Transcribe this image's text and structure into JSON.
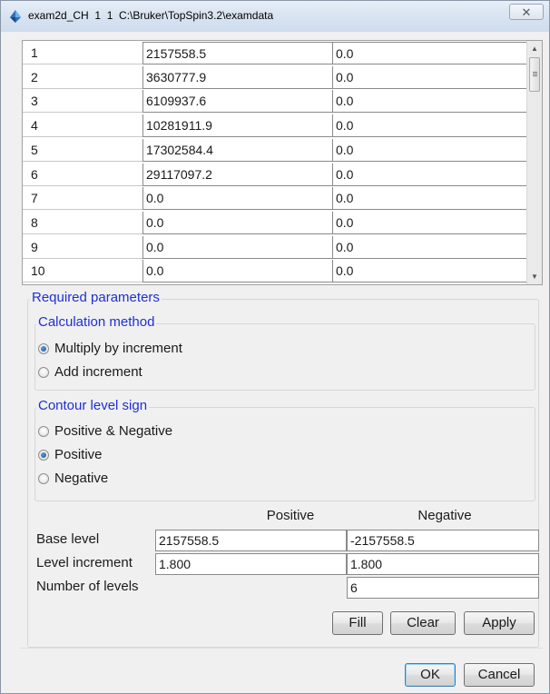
{
  "window": {
    "title": "exam2d_CH  1  1  C:\\Bruker\\TopSpin3.2\\examdata",
    "close_glyph": "✕",
    "icon": "topspin-app-icon"
  },
  "table": {
    "rows": [
      {
        "index": "1",
        "positive": "2157558.5",
        "negative": "0.0"
      },
      {
        "index": "2",
        "positive": "3630777.9",
        "negative": "0.0"
      },
      {
        "index": "3",
        "positive": "6109937.6",
        "negative": "0.0"
      },
      {
        "index": "4",
        "positive": "10281911.9",
        "negative": "0.0"
      },
      {
        "index": "5",
        "positive": "17302584.4",
        "negative": "0.0"
      },
      {
        "index": "6",
        "positive": "29117097.2",
        "negative": "0.0"
      },
      {
        "index": "7",
        "positive": "0.0",
        "negative": "0.0"
      },
      {
        "index": "8",
        "positive": "0.0",
        "negative": "0.0"
      },
      {
        "index": "9",
        "positive": "0.0",
        "negative": "0.0"
      },
      {
        "index": "10",
        "positive": "0.0",
        "negative": "0.0"
      }
    ],
    "scroll_up_glyph": "▲",
    "scroll_down_glyph": "▼"
  },
  "required_parameters": {
    "title": "Required parameters",
    "calculation_method": {
      "title": "Calculation method",
      "options": [
        {
          "label": "Multiply by increment",
          "checked": true
        },
        {
          "label": "Add increment",
          "checked": false
        }
      ]
    },
    "contour_level_sign": {
      "title": "Contour level sign",
      "options": [
        {
          "label": "Positive & Negative",
          "checked": false
        },
        {
          "label": "Positive",
          "checked": true
        },
        {
          "label": "Negative",
          "checked": false
        }
      ]
    },
    "levels": {
      "header_positive": "Positive",
      "header_negative": "Negative",
      "base_level_label": "Base level",
      "base_level_positive": "2157558.5",
      "base_level_negative": "-2157558.5",
      "level_increment_label": "Level increment",
      "level_increment_positive": "1.800",
      "level_increment_negative": "1.800",
      "number_of_levels_label": "Number of levels",
      "number_of_levels": "6"
    },
    "buttons": {
      "fill": "Fill",
      "clear": "Clear",
      "apply": "Apply"
    }
  },
  "dialog_buttons": {
    "ok": "OK",
    "cancel": "Cancel"
  },
  "colors": {
    "legend_text": "#1e2fd6",
    "window_bg": "#f0f0f0"
  }
}
